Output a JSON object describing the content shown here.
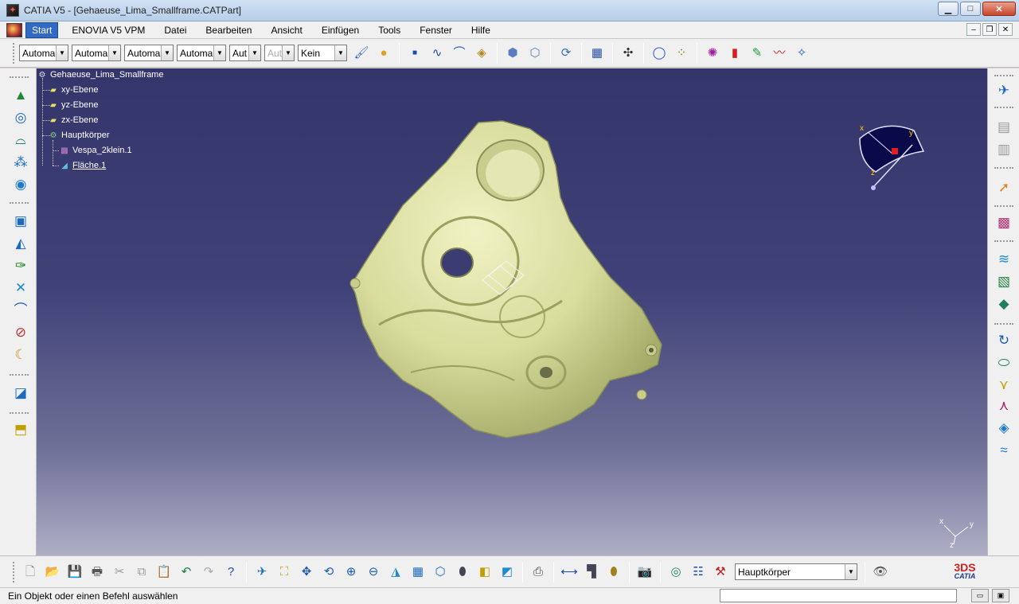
{
  "window": {
    "title": "CATIA V5 - [Gehaeuse_Lima_Smallframe.CATPart]",
    "minimize": "▁",
    "maximize": "□",
    "close": "✕"
  },
  "menu": {
    "items": [
      "Start",
      "ENOVIA V5 VPM",
      "Datei",
      "Bearbeiten",
      "Ansicht",
      "Einfügen",
      "Tools",
      "Fenster",
      "Hilfe"
    ],
    "mdi_minimize": "–",
    "mdi_restore": "❐",
    "mdi_close": "✕"
  },
  "top_toolbar": {
    "combos": [
      "Automa",
      "Automa",
      "Automa",
      "Automa",
      "Aut",
      "Aut",
      "Kein"
    ]
  },
  "tree": {
    "root": "Gehaeuse_Lima_Smallframe",
    "planes": [
      "xy-Ebene",
      "yz-Ebene",
      "zx-Ebene"
    ],
    "body": "Hauptkörper",
    "body_children": [
      "Vespa_2klein.1",
      "Fläche.1"
    ]
  },
  "compass": {
    "x_label": "x",
    "y_label": "y",
    "z_label": "z"
  },
  "axis_triad": {
    "x_label": "x",
    "y_label": "y",
    "z_label": "z"
  },
  "bottom_toolbar": {
    "current_body": "Hauptkörper"
  },
  "status": {
    "message": "Ein Objekt oder einen Befehl auswählen",
    "cmd_value": ""
  },
  "logo": {
    "ds": "3DS",
    "name": "CATIA"
  },
  "colors": {
    "viewport_top": "#34356a",
    "viewport_bottom": "#aeaec6",
    "part_fill": "#e0e4a8",
    "part_shade": "#a8ae6c",
    "selection_blue": "#316ac5"
  },
  "icons": {
    "left": [
      "sketch-icon",
      "fill-icon",
      "sweep-icon",
      "points-icon",
      "sphere-icon",
      "boolean-icon",
      "rough-offset-icon",
      "edit-icon",
      "intersect-icon",
      "curve-icon",
      "trim-icon",
      "fillet-icon",
      "plane-icon",
      "annotation-icon"
    ],
    "right": [
      "select-icon",
      "fly-icon",
      "render-icon",
      "pointer-icon",
      "mesh-icon",
      "surface-check-icon",
      "surface-icon",
      "patch-icon",
      "curvature-icon",
      "blend-icon",
      "fold-icon",
      "extend-icon",
      "connect-icon",
      "deviation-icon"
    ]
  }
}
